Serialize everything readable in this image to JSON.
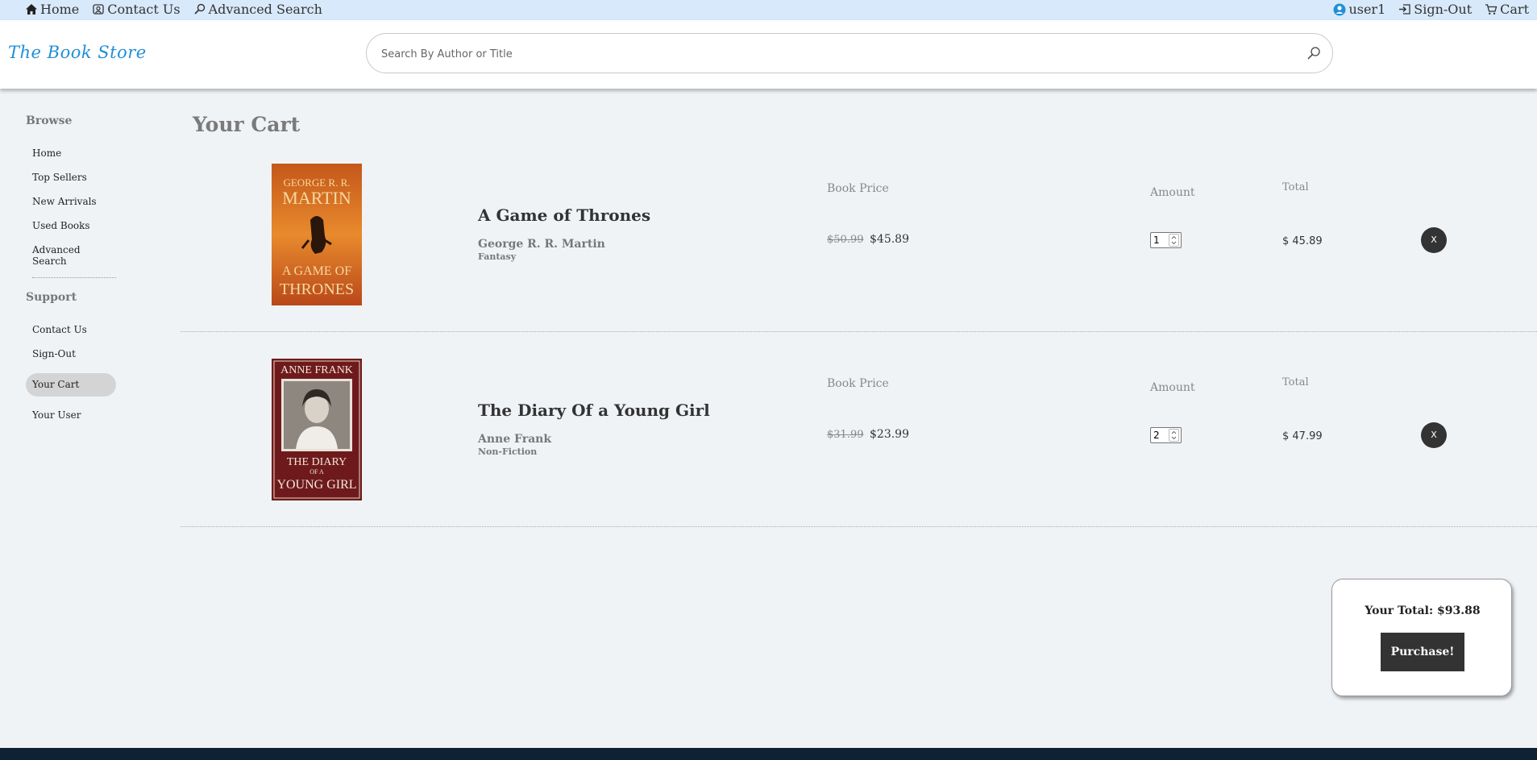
{
  "topnav": {
    "home": "Home",
    "contact": "Contact Us",
    "advanced_search": "Advanced Search",
    "user": "user1",
    "signout": "Sign-Out",
    "cart": "Cart"
  },
  "header": {
    "logo": "The Book Store",
    "search_placeholder": "Search By Author or Title"
  },
  "sidebar": {
    "browse_heading": "Browse",
    "browse_items": [
      "Home",
      "Top Sellers",
      "New Arrivals",
      "Used Books",
      "Advanced Search"
    ],
    "support_heading": "Support",
    "support_items": [
      "Contact Us",
      "Sign-Out",
      "Your Cart",
      "Your User"
    ],
    "active_item": "Your Cart"
  },
  "main": {
    "title": "Your Cart",
    "price_label": "Book Price",
    "amount_label": "Amount",
    "total_label": "Total",
    "remove_label": "X",
    "items": [
      {
        "cover_top": "GEORGE R. R. MARTIN",
        "cover_bottom": "A GAME OF THRONES",
        "title": "A Game of Thrones",
        "author": "George R. R. Martin",
        "genre": "Fantasy",
        "old_price": "$50.99",
        "price": "$45.89",
        "amount": "1",
        "total": "$ 45.89"
      },
      {
        "cover_top": "ANNE FRANK",
        "cover_bottom": "THE DIARY OF A YOUNG GIRL",
        "title": "The Diary Of a Young Girl",
        "author": "Anne Frank",
        "genre": "Non-Fiction",
        "old_price": "$31.99",
        "price": "$23.99",
        "amount": "2",
        "total": "$ 47.99"
      }
    ]
  },
  "summary": {
    "total_text": "Your Total: $93.88",
    "purchase_label": "Purchase!"
  },
  "colors": {
    "topbar": "#d7e9fa",
    "accent_logo": "#1f8fd6",
    "dark_button": "#333333",
    "footer": "#0e2233"
  }
}
